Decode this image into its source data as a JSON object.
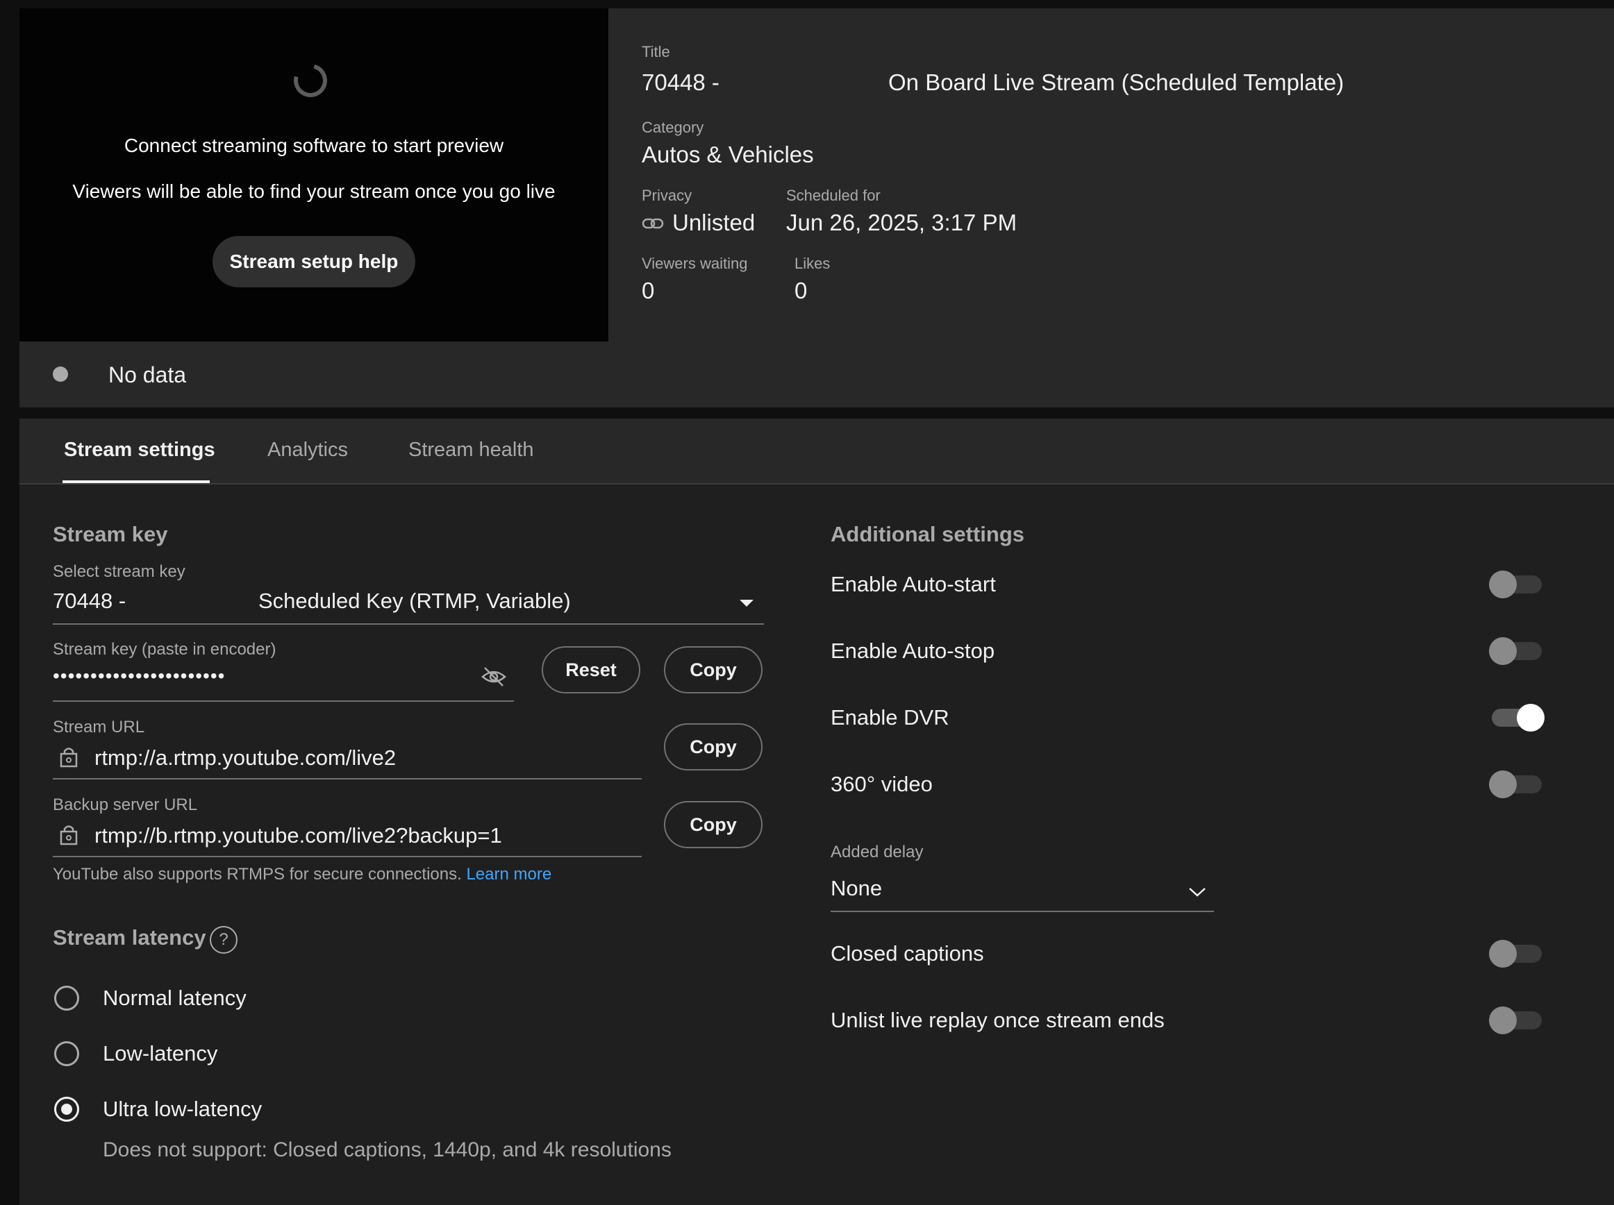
{
  "preview": {
    "message": "Connect streaming software to start preview",
    "submessage": "Viewers will be able to find your stream once you go live",
    "help_button": "Stream setup help"
  },
  "info": {
    "title_label": "Title",
    "title_prefix": "70448 -",
    "title_name": "On Board Live Stream (Scheduled Template)",
    "category_label": "Category",
    "category_value": "Autos & Vehicles",
    "privacy_label": "Privacy",
    "privacy_value": "Unlisted",
    "scheduled_label": "Scheduled for",
    "scheduled_value": "Jun 26, 2025, 3:17 PM",
    "viewers_label": "Viewers waiting",
    "viewers_value": "0",
    "likes_label": "Likes",
    "likes_value": "0"
  },
  "status": {
    "text": "No data"
  },
  "tabs": [
    {
      "label": "Stream settings",
      "active": true
    },
    {
      "label": "Analytics",
      "active": false
    },
    {
      "label": "Stream health",
      "active": false
    }
  ],
  "stream_key": {
    "heading": "Stream key",
    "select_label": "Select stream key",
    "select_prefix": "70448 -",
    "select_value": "Scheduled Key (RTMP, Variable)",
    "key_label": "Stream key (paste in encoder)",
    "key_value": "•••••••••••••••••••••••",
    "reset_button": "Reset",
    "copy_button": "Copy",
    "url_label": "Stream URL",
    "url_value": "rtmp://a.rtmp.youtube.com/live2",
    "backup_label": "Backup server URL",
    "backup_value": "rtmp://b.rtmp.youtube.com/live2?backup=1",
    "rtmps_note": "YouTube also supports RTMPS for secure connections.",
    "learn_more": "Learn more"
  },
  "latency": {
    "heading": "Stream latency",
    "options": [
      {
        "label": "Normal latency",
        "selected": false
      },
      {
        "label": "Low-latency",
        "selected": false
      },
      {
        "label": "Ultra low-latency",
        "selected": true
      }
    ],
    "note": "Does not support: Closed captions, 1440p, and 4k resolutions"
  },
  "additional": {
    "heading": "Additional settings",
    "auto_start": {
      "label": "Enable Auto-start",
      "on": false
    },
    "auto_stop": {
      "label": "Enable Auto-stop",
      "on": false
    },
    "dvr": {
      "label": "Enable DVR",
      "on": true
    },
    "video360": {
      "label": "360° video",
      "on": false
    },
    "delay_label": "Added delay",
    "delay_value": "None",
    "captions": {
      "label": "Closed captions",
      "on": false
    },
    "unlist": {
      "label": "Unlist live replay once stream ends",
      "on": false
    }
  },
  "colors": {
    "link": "#3ea6ff",
    "background": "#1f1f1f"
  }
}
